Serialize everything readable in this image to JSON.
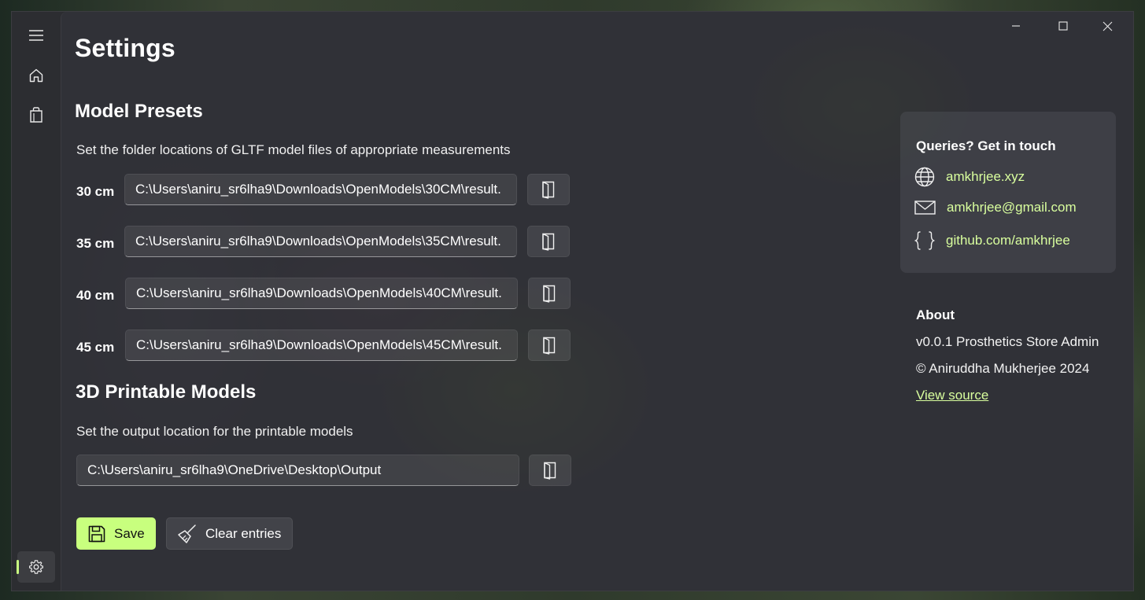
{
  "window": {
    "title": "Settings",
    "titlebar": {
      "minimize": "minimize",
      "maximize": "maximize",
      "close": "close"
    }
  },
  "nav": {
    "items": [
      {
        "icon": "hamburger-menu-icon"
      },
      {
        "icon": "home-icon"
      },
      {
        "icon": "shopping-bag-icon"
      }
    ],
    "footer": {
      "icon": "settings-gear-icon",
      "selected": true
    }
  },
  "model_presets": {
    "title": "Model Presets",
    "description": "Set the folder locations of GLTF model files of appropriate measurements",
    "rows": [
      {
        "label": "30 cm",
        "value": "C:\\Users\\aniru_sr6lha9\\Downloads\\OpenModels\\30CM\\result."
      },
      {
        "label": "35 cm",
        "value": "C:\\Users\\aniru_sr6lha9\\Downloads\\OpenModels\\35CM\\result."
      },
      {
        "label": "40 cm",
        "value": "C:\\Users\\aniru_sr6lha9\\Downloads\\OpenModels\\40CM\\result."
      },
      {
        "label": "45 cm",
        "value": "C:\\Users\\aniru_sr6lha9\\Downloads\\OpenModels\\45CM\\result."
      }
    ]
  },
  "printable_models": {
    "title": "3D Printable Models",
    "description": "Set the output location for the printable models",
    "value": "C:\\Users\\aniru_sr6lha9\\OneDrive\\Desktop\\Output"
  },
  "actions": {
    "save_label": "Save",
    "clear_label": "Clear entries"
  },
  "contact": {
    "title": "Queries? Get in touch",
    "website": "amkhrjee.xyz",
    "email": "amkhrjee@gmail.com",
    "github": "github.com/amkhrjee"
  },
  "about": {
    "title": "About",
    "version": "v0.0.1 Prosthetics Store Admin",
    "copyright": "© Aniruddha Mukherjee 2024",
    "view_source": "View source"
  },
  "colors": {
    "accent": "#c8ff7e",
    "link": "#d9ff9e",
    "window_bg": "#2c2d31"
  }
}
